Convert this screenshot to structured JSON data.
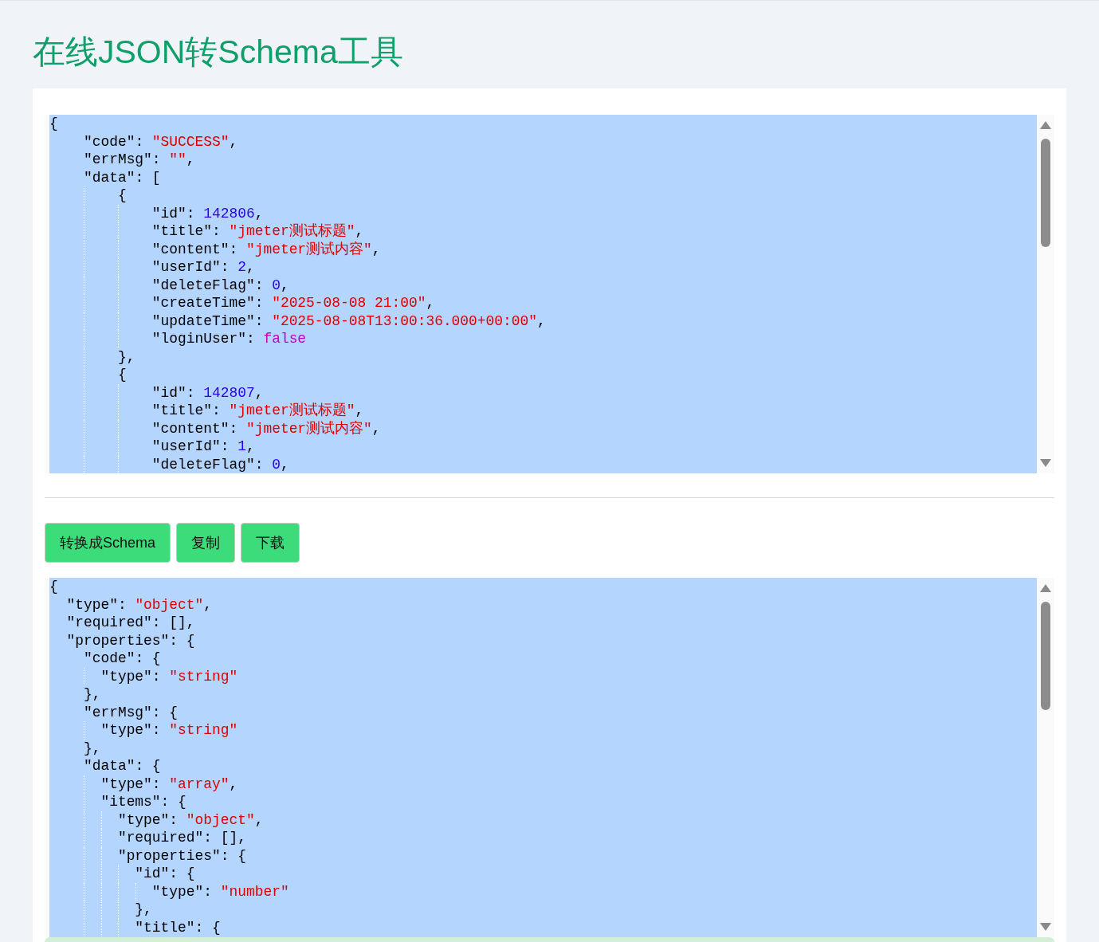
{
  "title": "在线JSON转Schema工具",
  "input_editor": {
    "lines": [
      [
        {
          "kind": "punct",
          "text": "{"
        }
      ],
      [
        {
          "kind": "key",
          "text": "    \"code\""
        },
        {
          "kind": "punct",
          "text": ": "
        },
        {
          "kind": "string",
          "text": "\"SUCCESS\""
        },
        {
          "kind": "punct",
          "text": ","
        }
      ],
      [
        {
          "kind": "key",
          "text": "    \"errMsg\""
        },
        {
          "kind": "punct",
          "text": ": "
        },
        {
          "kind": "string",
          "text": "\"\""
        },
        {
          "kind": "punct",
          "text": ","
        }
      ],
      [
        {
          "kind": "key",
          "text": "    \"data\""
        },
        {
          "kind": "punct",
          "text": ": ["
        }
      ],
      [
        {
          "kind": "punct",
          "text": "        {"
        }
      ],
      [
        {
          "kind": "key",
          "text": "            \"id\""
        },
        {
          "kind": "punct",
          "text": ": "
        },
        {
          "kind": "number",
          "text": "142806"
        },
        {
          "kind": "punct",
          "text": ","
        }
      ],
      [
        {
          "kind": "key",
          "text": "            \"title\""
        },
        {
          "kind": "punct",
          "text": ": "
        },
        {
          "kind": "string",
          "text": "\"jmeter测试标题\""
        },
        {
          "kind": "punct",
          "text": ","
        }
      ],
      [
        {
          "kind": "key",
          "text": "            \"content\""
        },
        {
          "kind": "punct",
          "text": ": "
        },
        {
          "kind": "string",
          "text": "\"jmeter测试内容\""
        },
        {
          "kind": "punct",
          "text": ","
        }
      ],
      [
        {
          "kind": "key",
          "text": "            \"userId\""
        },
        {
          "kind": "punct",
          "text": ": "
        },
        {
          "kind": "number",
          "text": "2"
        },
        {
          "kind": "punct",
          "text": ","
        }
      ],
      [
        {
          "kind": "key",
          "text": "            \"deleteFlag\""
        },
        {
          "kind": "punct",
          "text": ": "
        },
        {
          "kind": "number",
          "text": "0"
        },
        {
          "kind": "punct",
          "text": ","
        }
      ],
      [
        {
          "kind": "key",
          "text": "            \"createTime\""
        },
        {
          "kind": "punct",
          "text": ": "
        },
        {
          "kind": "string",
          "text": "\"2025-08-08 21:00\""
        },
        {
          "kind": "punct",
          "text": ","
        }
      ],
      [
        {
          "kind": "key",
          "text": "            \"updateTime\""
        },
        {
          "kind": "punct",
          "text": ": "
        },
        {
          "kind": "string",
          "text": "\"2025-08-08T13:00:36.000+00:00\""
        },
        {
          "kind": "punct",
          "text": ","
        }
      ],
      [
        {
          "kind": "key",
          "text": "            \"loginUser\""
        },
        {
          "kind": "punct",
          "text": ": "
        },
        {
          "kind": "boolean",
          "text": "false"
        }
      ],
      [
        {
          "kind": "punct",
          "text": "        },"
        }
      ],
      [
        {
          "kind": "punct",
          "text": "        {"
        }
      ],
      [
        {
          "kind": "key",
          "text": "            \"id\""
        },
        {
          "kind": "punct",
          "text": ": "
        },
        {
          "kind": "number",
          "text": "142807"
        },
        {
          "kind": "punct",
          "text": ","
        }
      ],
      [
        {
          "kind": "key",
          "text": "            \"title\""
        },
        {
          "kind": "punct",
          "text": ": "
        },
        {
          "kind": "string",
          "text": "\"jmeter测试标题\""
        },
        {
          "kind": "punct",
          "text": ","
        }
      ],
      [
        {
          "kind": "key",
          "text": "            \"content\""
        },
        {
          "kind": "punct",
          "text": ": "
        },
        {
          "kind": "string",
          "text": "\"jmeter测试内容\""
        },
        {
          "kind": "punct",
          "text": ","
        }
      ],
      [
        {
          "kind": "key",
          "text": "            \"userId\""
        },
        {
          "kind": "punct",
          "text": ": "
        },
        {
          "kind": "number",
          "text": "1"
        },
        {
          "kind": "punct",
          "text": ","
        }
      ],
      [
        {
          "kind": "key",
          "text": "            \"deleteFlag\""
        },
        {
          "kind": "punct",
          "text": ": "
        },
        {
          "kind": "number",
          "text": "0"
        },
        {
          "kind": "punct",
          "text": ","
        }
      ]
    ]
  },
  "buttons": [
    {
      "label": "转换成Schema"
    },
    {
      "label": "复制"
    },
    {
      "label": "下载"
    }
  ],
  "output_editor": {
    "lines": [
      [
        {
          "kind": "punct",
          "text": "{"
        }
      ],
      [
        {
          "kind": "key",
          "text": "  \"type\""
        },
        {
          "kind": "punct",
          "text": ": "
        },
        {
          "kind": "string",
          "text": "\"object\""
        },
        {
          "kind": "punct",
          "text": ","
        }
      ],
      [
        {
          "kind": "key",
          "text": "  \"required\""
        },
        {
          "kind": "punct",
          "text": ": [],"
        }
      ],
      [
        {
          "kind": "key",
          "text": "  \"properties\""
        },
        {
          "kind": "punct",
          "text": ": {"
        }
      ],
      [
        {
          "kind": "key",
          "text": "    \"code\""
        },
        {
          "kind": "punct",
          "text": ": {"
        }
      ],
      [
        {
          "kind": "key",
          "text": "      \"type\""
        },
        {
          "kind": "punct",
          "text": ": "
        },
        {
          "kind": "string",
          "text": "\"string\""
        }
      ],
      [
        {
          "kind": "punct",
          "text": "    },"
        }
      ],
      [
        {
          "kind": "key",
          "text": "    \"errMsg\""
        },
        {
          "kind": "punct",
          "text": ": {"
        }
      ],
      [
        {
          "kind": "key",
          "text": "      \"type\""
        },
        {
          "kind": "punct",
          "text": ": "
        },
        {
          "kind": "string",
          "text": "\"string\""
        }
      ],
      [
        {
          "kind": "punct",
          "text": "    },"
        }
      ],
      [
        {
          "kind": "key",
          "text": "    \"data\""
        },
        {
          "kind": "punct",
          "text": ": {"
        }
      ],
      [
        {
          "kind": "key",
          "text": "      \"type\""
        },
        {
          "kind": "punct",
          "text": ": "
        },
        {
          "kind": "string",
          "text": "\"array\""
        },
        {
          "kind": "punct",
          "text": ","
        }
      ],
      [
        {
          "kind": "key",
          "text": "      \"items\""
        },
        {
          "kind": "punct",
          "text": ": {"
        }
      ],
      [
        {
          "kind": "key",
          "text": "        \"type\""
        },
        {
          "kind": "punct",
          "text": ": "
        },
        {
          "kind": "string",
          "text": "\"object\""
        },
        {
          "kind": "punct",
          "text": ","
        }
      ],
      [
        {
          "kind": "key",
          "text": "        \"required\""
        },
        {
          "kind": "punct",
          "text": ": [],"
        }
      ],
      [
        {
          "kind": "key",
          "text": "        \"properties\""
        },
        {
          "kind": "punct",
          "text": ": {"
        }
      ],
      [
        {
          "kind": "key",
          "text": "          \"id\""
        },
        {
          "kind": "punct",
          "text": ": {"
        }
      ],
      [
        {
          "kind": "key",
          "text": "            \"type\""
        },
        {
          "kind": "punct",
          "text": ": "
        },
        {
          "kind": "string",
          "text": "\"number\""
        }
      ],
      [
        {
          "kind": "punct",
          "text": "          },"
        }
      ],
      [
        {
          "kind": "key",
          "text": "          \"title\""
        },
        {
          "kind": "punct",
          "text": ": {"
        }
      ]
    ]
  }
}
